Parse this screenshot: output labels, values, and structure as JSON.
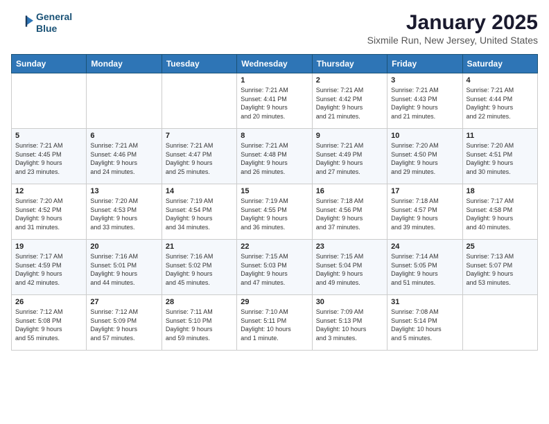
{
  "header": {
    "logo_line1": "General",
    "logo_line2": "Blue",
    "month": "January 2025",
    "location": "Sixmile Run, New Jersey, United States"
  },
  "weekdays": [
    "Sunday",
    "Monday",
    "Tuesday",
    "Wednesday",
    "Thursday",
    "Friday",
    "Saturday"
  ],
  "weeks": [
    [
      {
        "day": "",
        "info": ""
      },
      {
        "day": "",
        "info": ""
      },
      {
        "day": "",
        "info": ""
      },
      {
        "day": "1",
        "info": "Sunrise: 7:21 AM\nSunset: 4:41 PM\nDaylight: 9 hours\nand 20 minutes."
      },
      {
        "day": "2",
        "info": "Sunrise: 7:21 AM\nSunset: 4:42 PM\nDaylight: 9 hours\nand 21 minutes."
      },
      {
        "day": "3",
        "info": "Sunrise: 7:21 AM\nSunset: 4:43 PM\nDaylight: 9 hours\nand 21 minutes."
      },
      {
        "day": "4",
        "info": "Sunrise: 7:21 AM\nSunset: 4:44 PM\nDaylight: 9 hours\nand 22 minutes."
      }
    ],
    [
      {
        "day": "5",
        "info": "Sunrise: 7:21 AM\nSunset: 4:45 PM\nDaylight: 9 hours\nand 23 minutes."
      },
      {
        "day": "6",
        "info": "Sunrise: 7:21 AM\nSunset: 4:46 PM\nDaylight: 9 hours\nand 24 minutes."
      },
      {
        "day": "7",
        "info": "Sunrise: 7:21 AM\nSunset: 4:47 PM\nDaylight: 9 hours\nand 25 minutes."
      },
      {
        "day": "8",
        "info": "Sunrise: 7:21 AM\nSunset: 4:48 PM\nDaylight: 9 hours\nand 26 minutes."
      },
      {
        "day": "9",
        "info": "Sunrise: 7:21 AM\nSunset: 4:49 PM\nDaylight: 9 hours\nand 27 minutes."
      },
      {
        "day": "10",
        "info": "Sunrise: 7:20 AM\nSunset: 4:50 PM\nDaylight: 9 hours\nand 29 minutes."
      },
      {
        "day": "11",
        "info": "Sunrise: 7:20 AM\nSunset: 4:51 PM\nDaylight: 9 hours\nand 30 minutes."
      }
    ],
    [
      {
        "day": "12",
        "info": "Sunrise: 7:20 AM\nSunset: 4:52 PM\nDaylight: 9 hours\nand 31 minutes."
      },
      {
        "day": "13",
        "info": "Sunrise: 7:20 AM\nSunset: 4:53 PM\nDaylight: 9 hours\nand 33 minutes."
      },
      {
        "day": "14",
        "info": "Sunrise: 7:19 AM\nSunset: 4:54 PM\nDaylight: 9 hours\nand 34 minutes."
      },
      {
        "day": "15",
        "info": "Sunrise: 7:19 AM\nSunset: 4:55 PM\nDaylight: 9 hours\nand 36 minutes."
      },
      {
        "day": "16",
        "info": "Sunrise: 7:18 AM\nSunset: 4:56 PM\nDaylight: 9 hours\nand 37 minutes."
      },
      {
        "day": "17",
        "info": "Sunrise: 7:18 AM\nSunset: 4:57 PM\nDaylight: 9 hours\nand 39 minutes."
      },
      {
        "day": "18",
        "info": "Sunrise: 7:17 AM\nSunset: 4:58 PM\nDaylight: 9 hours\nand 40 minutes."
      }
    ],
    [
      {
        "day": "19",
        "info": "Sunrise: 7:17 AM\nSunset: 4:59 PM\nDaylight: 9 hours\nand 42 minutes."
      },
      {
        "day": "20",
        "info": "Sunrise: 7:16 AM\nSunset: 5:01 PM\nDaylight: 9 hours\nand 44 minutes."
      },
      {
        "day": "21",
        "info": "Sunrise: 7:16 AM\nSunset: 5:02 PM\nDaylight: 9 hours\nand 45 minutes."
      },
      {
        "day": "22",
        "info": "Sunrise: 7:15 AM\nSunset: 5:03 PM\nDaylight: 9 hours\nand 47 minutes."
      },
      {
        "day": "23",
        "info": "Sunrise: 7:15 AM\nSunset: 5:04 PM\nDaylight: 9 hours\nand 49 minutes."
      },
      {
        "day": "24",
        "info": "Sunrise: 7:14 AM\nSunset: 5:05 PM\nDaylight: 9 hours\nand 51 minutes."
      },
      {
        "day": "25",
        "info": "Sunrise: 7:13 AM\nSunset: 5:07 PM\nDaylight: 9 hours\nand 53 minutes."
      }
    ],
    [
      {
        "day": "26",
        "info": "Sunrise: 7:12 AM\nSunset: 5:08 PM\nDaylight: 9 hours\nand 55 minutes."
      },
      {
        "day": "27",
        "info": "Sunrise: 7:12 AM\nSunset: 5:09 PM\nDaylight: 9 hours\nand 57 minutes."
      },
      {
        "day": "28",
        "info": "Sunrise: 7:11 AM\nSunset: 5:10 PM\nDaylight: 9 hours\nand 59 minutes."
      },
      {
        "day": "29",
        "info": "Sunrise: 7:10 AM\nSunset: 5:11 PM\nDaylight: 10 hours\nand 1 minute."
      },
      {
        "day": "30",
        "info": "Sunrise: 7:09 AM\nSunset: 5:13 PM\nDaylight: 10 hours\nand 3 minutes."
      },
      {
        "day": "31",
        "info": "Sunrise: 7:08 AM\nSunset: 5:14 PM\nDaylight: 10 hours\nand 5 minutes."
      },
      {
        "day": "",
        "info": ""
      }
    ]
  ]
}
